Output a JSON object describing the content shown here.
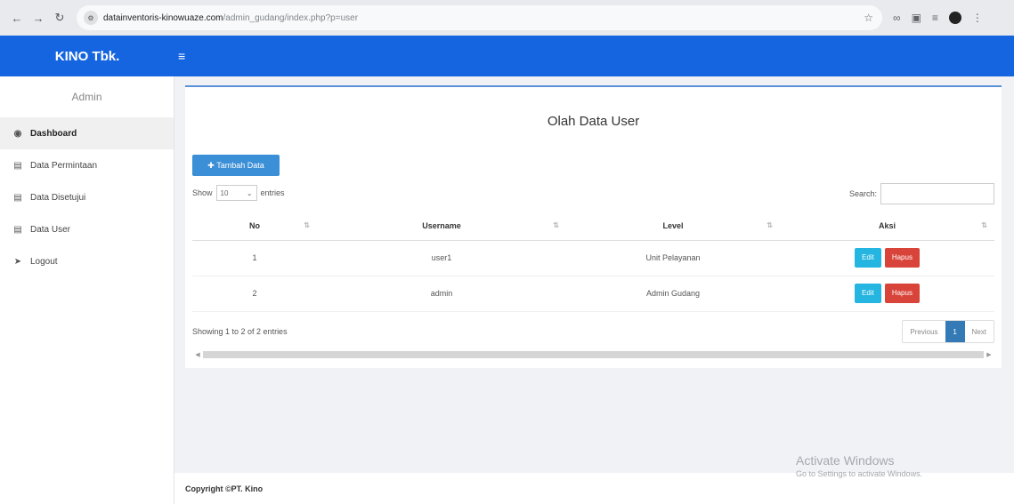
{
  "browser": {
    "url_host": "datainventoris-kinowuaze.com",
    "url_path": "/admin_gudang/index.php?p=user"
  },
  "app": {
    "brand": "KINO Tbk."
  },
  "sidebar": {
    "user_label": "Admin",
    "items": [
      {
        "label": "Dashboard",
        "icon": "dashboard-icon",
        "active": true
      },
      {
        "label": "Data Permintaan",
        "icon": "clipboard-icon",
        "active": false
      },
      {
        "label": "Data Disetujui",
        "icon": "clipboard-icon",
        "active": false
      },
      {
        "label": "Data User",
        "icon": "clipboard-icon",
        "active": false
      },
      {
        "label": "Logout",
        "icon": "logout-icon",
        "active": false
      }
    ]
  },
  "main": {
    "title": "Olah Data User",
    "add_button_label": "Tambah Data",
    "length_label_before": "Show",
    "length_value": "10",
    "length_label_after": "entries",
    "search_label": "Search:",
    "search_value": "",
    "columns": [
      "No",
      "Username",
      "Level",
      "Aksi"
    ],
    "rows": [
      {
        "no": "1",
        "username": "user1",
        "level": "Unit Pelayanan"
      },
      {
        "no": "2",
        "username": "admin",
        "level": "Admin Gudang"
      }
    ],
    "edit_label": "Edit",
    "delete_label": "Hapus",
    "info": "Showing 1 to 2 of 2 entries",
    "pager": {
      "previous": "Previous",
      "current": "1",
      "next": "Next"
    }
  },
  "footer": {
    "copyright": "Copyright ©PT. Kino"
  },
  "watermark": {
    "title": "Activate Windows",
    "subtitle": "Go to Settings to activate Windows."
  },
  "colors": {
    "topbar": "#1565e0",
    "edit": "#24b5e0",
    "delete": "#d9443a",
    "pager_current": "#337ab7"
  }
}
